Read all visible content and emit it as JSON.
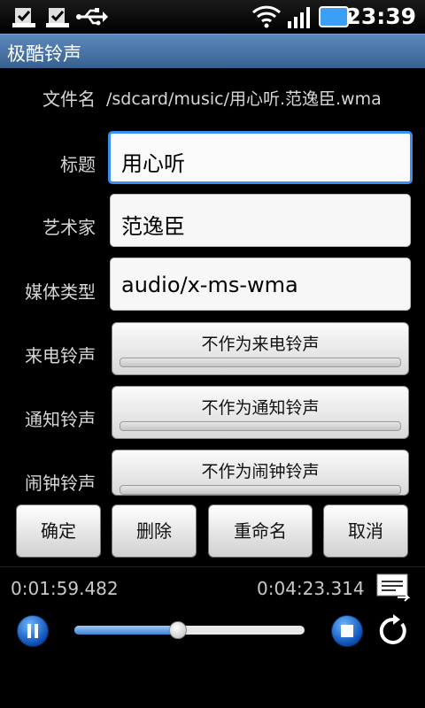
{
  "status": {
    "time": "23:39",
    "icons": [
      "download-check-icon",
      "download-check-icon",
      "usb-icon",
      "wifi-icon",
      "signal-icon",
      "battery-icon"
    ]
  },
  "app_title": "极酷铃声",
  "file": {
    "label": "文件名",
    "value": "/sdcard/music/用心听.范逸臣.wma"
  },
  "fields": {
    "title_label": "标题",
    "title_value": "用心听",
    "artist_label": "艺术家",
    "artist_value": "范逸臣",
    "media_label": "媒体类型",
    "media_value": "audio/x-ms-wma"
  },
  "ringtones": {
    "call_label": "来电铃声",
    "call_button": "不作为来电铃声",
    "notify_label": "通知铃声",
    "notify_button": "不作为通知铃声",
    "alarm_label": "闹钟铃声",
    "alarm_button": "不作为闹钟铃声"
  },
  "actions": {
    "ok": "确定",
    "delete": "删除",
    "rename": "重命名",
    "cancel": "取消"
  },
  "player": {
    "elapsed": "0:01:59.482",
    "total": "0:04:23.314",
    "progress": 0.445
  },
  "colors": {
    "accent": "#3a8ff0",
    "titlebar": "#4a76a8"
  }
}
